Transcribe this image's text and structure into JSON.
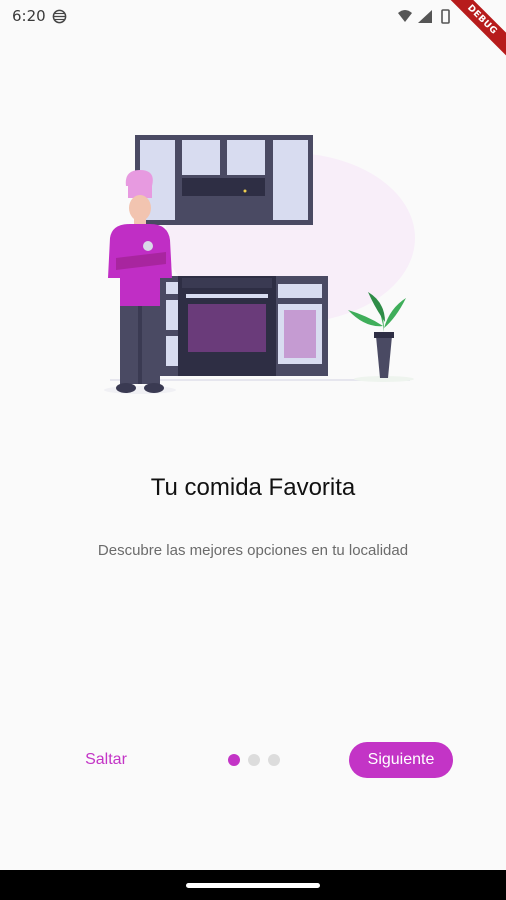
{
  "status_bar": {
    "time": "6:20",
    "debug_label": "DEBUG"
  },
  "onboarding": {
    "title": "Tu comida Favorita",
    "subtitle": "Descubre las mejores opciones en tu localidad",
    "skip_label": "Saltar",
    "next_label": "Siguiente",
    "page_count": 3,
    "current_page": 1
  },
  "colors": {
    "accent": "#c334c6",
    "dot_inactive": "#dcdcdc",
    "background": "#fafafa"
  }
}
